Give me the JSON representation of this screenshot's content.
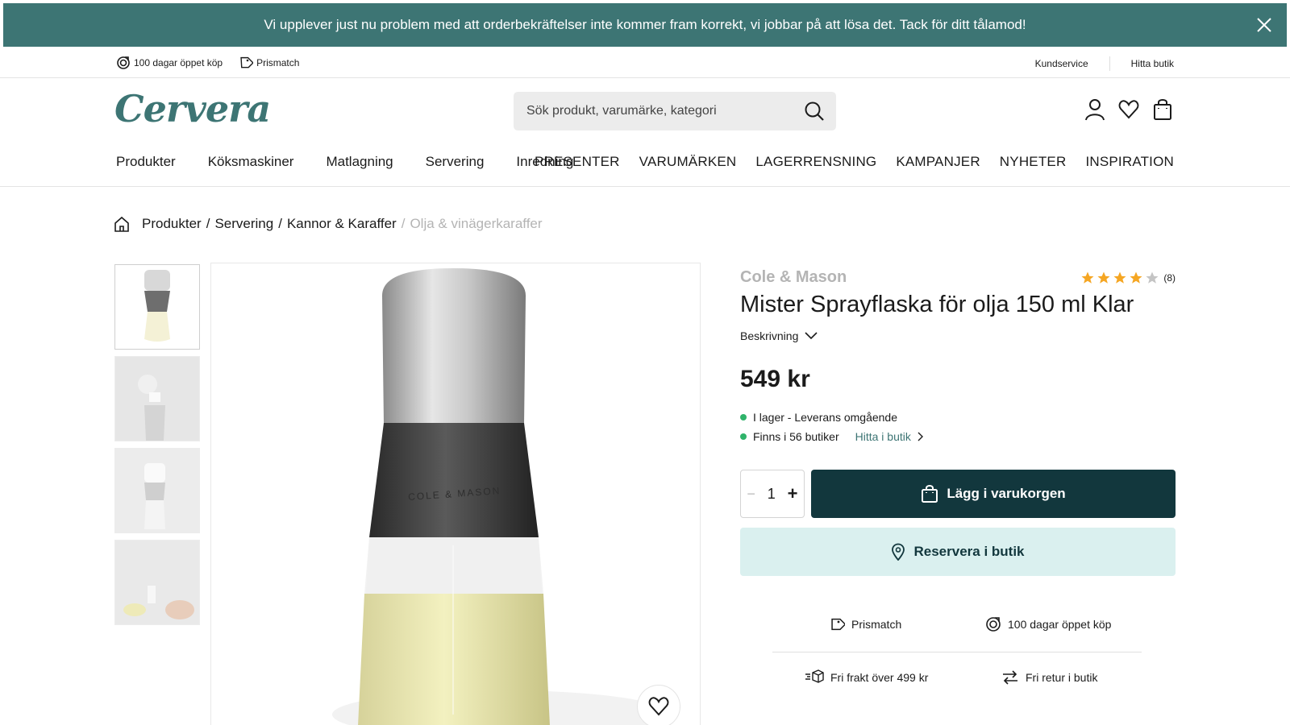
{
  "banner": {
    "message": "Vi upplever just nu problem med att orderbekräftelser inte kommer fram korrekt, vi jobbar på att lösa det. Tack för ditt tålamod!"
  },
  "utility": {
    "left": [
      {
        "label": "100 dagar öppet köp",
        "icon": "return-icon"
      },
      {
        "label": "Prismatch",
        "icon": "price-tag-icon"
      }
    ],
    "right": [
      "Kundservice",
      "Hitta butik"
    ]
  },
  "header": {
    "logo": "Cervera",
    "search_placeholder": "Sök produkt, varumärke, kategori"
  },
  "nav": {
    "left": [
      "Produkter",
      "Köksmaskiner",
      "Matlagning",
      "Servering",
      "Inredning"
    ],
    "right": [
      "PRESENTER",
      "VARUMÄRKEN",
      "LAGERRENSNING",
      "KAMPANJER",
      "NYHETER",
      "INSPIRATION"
    ]
  },
  "breadcrumb": {
    "items": [
      "Produkter",
      "Servering",
      "Kannor & Karaffer"
    ],
    "separator": "/",
    "current": "Olja & vinägerkaraffer"
  },
  "product": {
    "brand": "Cole & Mason",
    "title": "Mister Sprayflaska för olja 150 ml Klar",
    "description_label": "Beskrivning",
    "rating": 4,
    "rating_max": 5,
    "review_count": "(8)",
    "price": "549 kr",
    "stock": "I lager - Leverans omgående",
    "stores": "Finns i 56 butiker",
    "find_in_store": "Hitta i butik",
    "quantity": "1",
    "add_to_cart": "Lägg i varukorgen",
    "reserve": "Reservera i butik",
    "bottle_engraving": "COLE & MASON"
  },
  "usps": {
    "price_match": "Prismatch",
    "open_purchase": "100 dagar öppet köp",
    "free_shipping": "Fri frakt över 499 kr",
    "free_return": "Fri retur i butik"
  },
  "colors": {
    "brand": "#3d7574",
    "primary_button": "#12373d",
    "reserve_button": "#daf0ef",
    "stock_dot": "#2fb36a",
    "star": "#f5a623"
  }
}
